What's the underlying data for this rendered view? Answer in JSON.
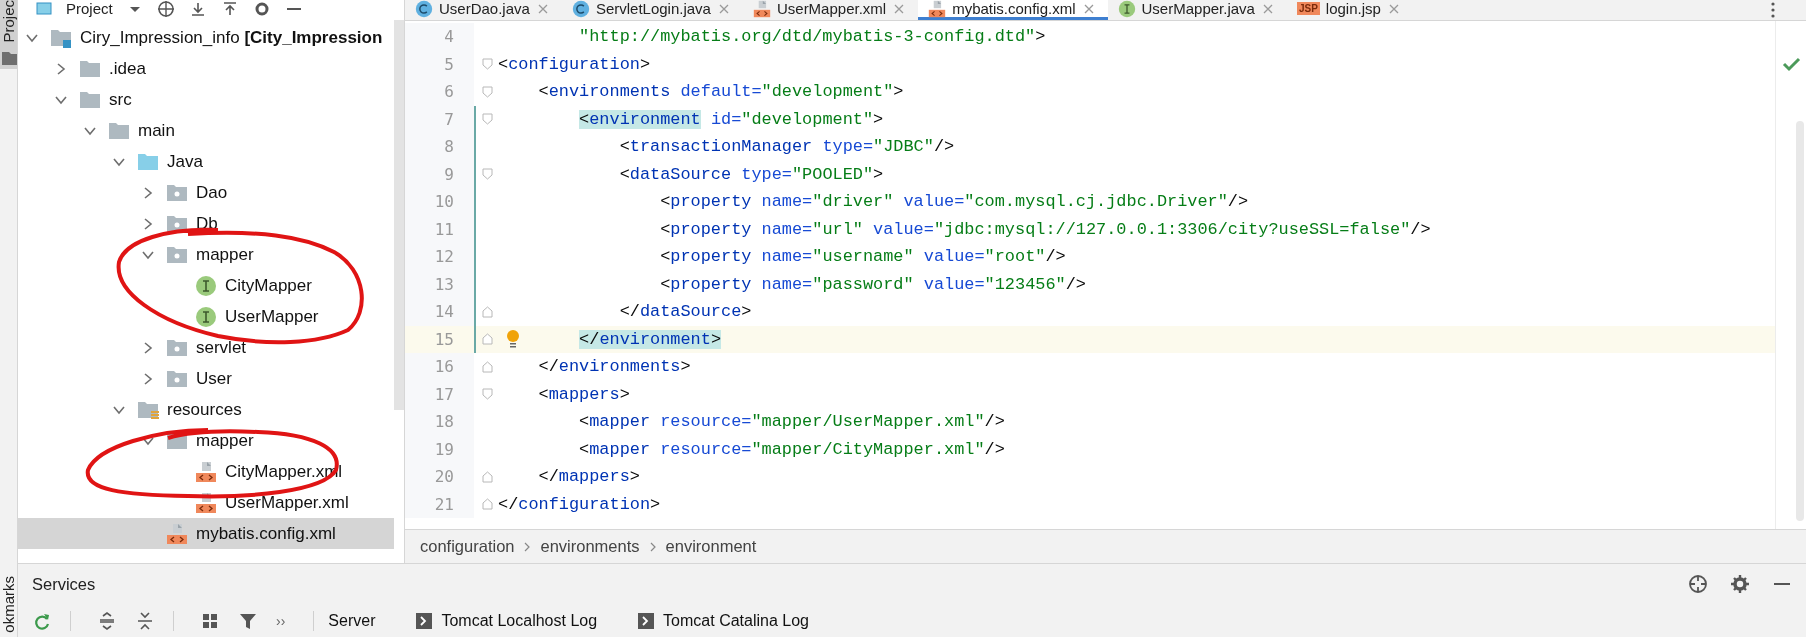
{
  "side_tabs": [
    {
      "label": "Projec",
      "selected": true
    },
    {
      "label": "okmarks",
      "selected": false
    }
  ],
  "project_panel": {
    "title": "Project",
    "tree": [
      {
        "label": "Ciry_Impression_info **[City_Impression**",
        "kind": "module",
        "expanded": true,
        "selected": false,
        "children": [
          {
            "label": ".idea",
            "kind": "folder",
            "expanded": false,
            "selected": false
          },
          {
            "label": "src",
            "kind": "folder",
            "expanded": true,
            "selected": false,
            "children": [
              {
                "label": "main",
                "kind": "folder",
                "expanded": true,
                "selected": false,
                "children": [
                  {
                    "label": "Java",
                    "kind": "source-folder",
                    "expanded": true,
                    "selected": false,
                    "children": [
                      {
                        "label": "Dao",
                        "kind": "package",
                        "expanded": false,
                        "selected": false
                      },
                      {
                        "label": "Db",
                        "kind": "package",
                        "expanded": false,
                        "selected": false
                      },
                      {
                        "label": "mapper",
                        "kind": "package",
                        "expanded": true,
                        "selected": false,
                        "children": [
                          {
                            "label": "CityMapper",
                            "kind": "interface",
                            "selected": false
                          },
                          {
                            "label": "UserMapper",
                            "kind": "interface",
                            "selected": false
                          }
                        ]
                      },
                      {
                        "label": "servlet",
                        "kind": "package",
                        "expanded": false,
                        "selected": false
                      },
                      {
                        "label": "User",
                        "kind": "package",
                        "expanded": false,
                        "selected": false
                      }
                    ]
                  },
                  {
                    "label": "resources",
                    "kind": "resources-folder",
                    "expanded": true,
                    "selected": false,
                    "children": [
                      {
                        "label": "mapper",
                        "kind": "folder",
                        "expanded": true,
                        "selected": false,
                        "children": [
                          {
                            "label": "CityMapper.xml",
                            "kind": "xml",
                            "selected": false
                          },
                          {
                            "label": "UserMapper.xml",
                            "kind": "xml",
                            "selected": false
                          }
                        ]
                      },
                      {
                        "label": "mybatis.config.xml",
                        "kind": "xml",
                        "selected": true
                      }
                    ]
                  }
                ]
              }
            ]
          }
        ]
      }
    ]
  },
  "editor": {
    "tabs": [
      {
        "label": "UserDao.java",
        "kind": "class",
        "selected": false
      },
      {
        "label": "ServletLogin.java",
        "kind": "class",
        "selected": false
      },
      {
        "label": "UserMapper.xml",
        "kind": "xml",
        "selected": false
      },
      {
        "label": "mybatis.config.xml",
        "kind": "xml",
        "selected": true
      },
      {
        "label": "UserMapper.java",
        "kind": "interface",
        "selected": false
      },
      {
        "label": "login.jsp",
        "kind": "jsp",
        "icon_label": "JSP",
        "selected": false
      }
    ],
    "lines": [
      {
        "number": "4",
        "kind": "plain",
        "changed": false,
        "current": false,
        "tokens": [
          {
            "kind": "str",
            "text": "        \"http://mybatis.org/dtd/mybatis-3-config.dtd\"",
            "match": false
          },
          {
            "kind": "punct",
            "text": ">",
            "match": false
          }
        ]
      },
      {
        "number": "5",
        "kind": "fold-start",
        "changed": false,
        "current": false,
        "tokens": [
          {
            "kind": "punct",
            "text": "<",
            "match": false
          },
          {
            "kind": "tag",
            "text": "configuration",
            "match": false
          },
          {
            "kind": "punct",
            "text": ">",
            "match": false
          }
        ]
      },
      {
        "number": "6",
        "kind": "fold-start",
        "changed": false,
        "current": false,
        "tokens": [
          {
            "kind": "punct",
            "text": "    <",
            "match": false
          },
          {
            "kind": "tag",
            "text": "environments",
            "match": false
          },
          {
            "kind": "attr",
            "text": " default=",
            "match": false
          },
          {
            "kind": "str",
            "text": "\"development\"",
            "match": false
          },
          {
            "kind": "punct",
            "text": ">",
            "match": false
          }
        ]
      },
      {
        "number": "7",
        "kind": "fold-start",
        "changed": true,
        "current": false,
        "tokens": [
          {
            "kind": "punct",
            "text": "        <",
            "match": true
          },
          {
            "kind": "tag",
            "text": "environment",
            "match": true
          },
          {
            "kind": "attr",
            "text": " id=",
            "match": false
          },
          {
            "kind": "str",
            "text": "\"development\"",
            "match": false
          },
          {
            "kind": "punct",
            "text": ">",
            "match": false
          }
        ]
      },
      {
        "number": "8",
        "kind": "plain",
        "changed": true,
        "current": false,
        "tokens": [
          {
            "kind": "punct",
            "text": "            <",
            "match": false
          },
          {
            "kind": "tag",
            "text": "transactionManager",
            "match": false
          },
          {
            "kind": "attr",
            "text": " type=",
            "match": false
          },
          {
            "kind": "str",
            "text": "\"JDBC\"",
            "match": false
          },
          {
            "kind": "punct",
            "text": "/>",
            "match": false
          }
        ]
      },
      {
        "number": "9",
        "kind": "fold-start",
        "changed": true,
        "current": false,
        "tokens": [
          {
            "kind": "punct",
            "text": "            <",
            "match": false
          },
          {
            "kind": "tag",
            "text": "dataSource",
            "match": false
          },
          {
            "kind": "attr",
            "text": " type=",
            "match": false
          },
          {
            "kind": "str",
            "text": "\"POOLED\"",
            "match": false
          },
          {
            "kind": "punct",
            "text": ">",
            "match": false
          }
        ]
      },
      {
        "number": "10",
        "kind": "plain",
        "changed": true,
        "current": false,
        "tokens": [
          {
            "kind": "punct",
            "text": "                <",
            "match": false
          },
          {
            "kind": "tag",
            "text": "property",
            "match": false
          },
          {
            "kind": "attr",
            "text": " name=",
            "match": false
          },
          {
            "kind": "str",
            "text": "\"driver\"",
            "match": false
          },
          {
            "kind": "attr",
            "text": " value=",
            "match": false
          },
          {
            "kind": "str",
            "text": "\"com.mysql.cj.jdbc.Driver\"",
            "match": false
          },
          {
            "kind": "punct",
            "text": "/>",
            "match": false
          }
        ]
      },
      {
        "number": "11",
        "kind": "plain",
        "changed": true,
        "current": false,
        "tokens": [
          {
            "kind": "punct",
            "text": "                <",
            "match": false
          },
          {
            "kind": "tag",
            "text": "property",
            "match": false
          },
          {
            "kind": "attr",
            "text": " name=",
            "match": false
          },
          {
            "kind": "str",
            "text": "\"url\"",
            "match": false
          },
          {
            "kind": "attr",
            "text": " value=",
            "match": false
          },
          {
            "kind": "str",
            "text": "\"jdbc:mysql://127.0.0.1:3306/city?useSSL=false\"",
            "match": false
          },
          {
            "kind": "punct",
            "text": "/>",
            "match": false
          }
        ]
      },
      {
        "number": "12",
        "kind": "plain",
        "changed": true,
        "current": false,
        "tokens": [
          {
            "kind": "punct",
            "text": "                <",
            "match": false
          },
          {
            "kind": "tag",
            "text": "property",
            "match": false
          },
          {
            "kind": "attr",
            "text": " name=",
            "match": false
          },
          {
            "kind": "str",
            "text": "\"username\"",
            "match": false
          },
          {
            "kind": "attr",
            "text": " value=",
            "match": false
          },
          {
            "kind": "str",
            "text": "\"root\"",
            "match": false
          },
          {
            "kind": "punct",
            "text": "/>",
            "match": false
          }
        ]
      },
      {
        "number": "13",
        "kind": "plain",
        "changed": true,
        "current": false,
        "tokens": [
          {
            "kind": "punct",
            "text": "                <",
            "match": false
          },
          {
            "kind": "tag",
            "text": "property",
            "match": false
          },
          {
            "kind": "attr",
            "text": " name=",
            "match": false
          },
          {
            "kind": "str",
            "text": "\"password\"",
            "match": false
          },
          {
            "kind": "attr",
            "text": " value=",
            "match": false
          },
          {
            "kind": "str",
            "text": "\"123456\"",
            "match": false
          },
          {
            "kind": "punct",
            "text": "/>",
            "match": false
          }
        ]
      },
      {
        "number": "14",
        "kind": "fold-end",
        "changed": true,
        "current": false,
        "tokens": [
          {
            "kind": "punct",
            "text": "            </",
            "match": false
          },
          {
            "kind": "tag",
            "text": "dataSource",
            "match": false
          },
          {
            "kind": "punct",
            "text": ">",
            "match": false
          }
        ]
      },
      {
        "number": "15",
        "kind": "fold-end",
        "changed": true,
        "current": true,
        "bulb": true,
        "tokens": [
          {
            "kind": "punct",
            "text": "        </",
            "match": true
          },
          {
            "kind": "tag",
            "text": "environment",
            "match": true
          },
          {
            "kind": "punct",
            "text": ">",
            "match": true
          }
        ]
      },
      {
        "number": "16",
        "kind": "fold-end",
        "changed": false,
        "current": false,
        "tokens": [
          {
            "kind": "punct",
            "text": "    </",
            "match": false
          },
          {
            "kind": "tag",
            "text": "environments",
            "match": false
          },
          {
            "kind": "punct",
            "text": ">",
            "match": false
          }
        ]
      },
      {
        "number": "17",
        "kind": "fold-start",
        "changed": false,
        "current": false,
        "tokens": [
          {
            "kind": "punct",
            "text": "    <",
            "match": false
          },
          {
            "kind": "tag",
            "text": "mappers",
            "match": false
          },
          {
            "kind": "punct",
            "text": ">",
            "match": false
          }
        ]
      },
      {
        "number": "18",
        "kind": "plain",
        "changed": false,
        "current": false,
        "tokens": [
          {
            "kind": "punct",
            "text": "        <",
            "match": false
          },
          {
            "kind": "tag",
            "text": "mapper",
            "match": false
          },
          {
            "kind": "attr",
            "text": " resource=",
            "match": false
          },
          {
            "kind": "str",
            "text": "\"mapper/UserMapper.xml\"",
            "match": false
          },
          {
            "kind": "punct",
            "text": "/>",
            "match": false
          }
        ]
      },
      {
        "number": "19",
        "kind": "plain",
        "changed": false,
        "current": false,
        "tokens": [
          {
            "kind": "punct",
            "text": "        <",
            "match": false
          },
          {
            "kind": "tag",
            "text": "mapper",
            "match": false
          },
          {
            "kind": "attr",
            "text": " resource=",
            "match": false
          },
          {
            "kind": "str",
            "text": "\"mapper/CityMapper.xml\"",
            "match": false
          },
          {
            "kind": "punct",
            "text": "/>",
            "match": false
          }
        ]
      },
      {
        "number": "20",
        "kind": "fold-end",
        "changed": false,
        "current": false,
        "tokens": [
          {
            "kind": "punct",
            "text": "    </",
            "match": false
          },
          {
            "kind": "tag",
            "text": "mappers",
            "match": false
          },
          {
            "kind": "punct",
            "text": ">",
            "match": false
          }
        ]
      },
      {
        "number": "21",
        "kind": "fold-end",
        "changed": false,
        "current": false,
        "tokens": [
          {
            "kind": "punct",
            "text": "</",
            "match": false
          },
          {
            "kind": "tag",
            "text": "configuration",
            "match": false
          },
          {
            "kind": "punct",
            "text": ">",
            "match": false
          }
        ]
      }
    ],
    "breadcrumbs": [
      "configuration",
      "environments",
      "environment"
    ]
  },
  "services": {
    "title": "Services",
    "overflow_label": "››",
    "tabs": [
      {
        "label": "Server",
        "kind": "plain"
      },
      {
        "label": "Tomcat Localhost Log",
        "kind": "log"
      },
      {
        "label": "Tomcat Catalina Log",
        "kind": "log"
      }
    ]
  }
}
